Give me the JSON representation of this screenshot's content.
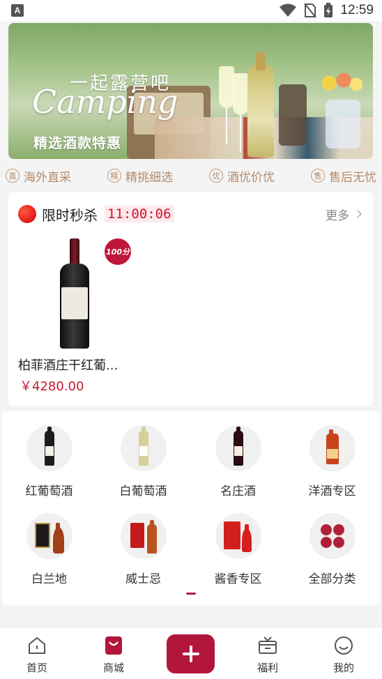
{
  "status_bar": {
    "app_badge": "A",
    "time": "12:59"
  },
  "banner": {
    "title_cn": "一起露营吧",
    "title_en": "Camping",
    "subtitle": "精选酒款特惠"
  },
  "features": [
    {
      "icon": "直",
      "label": "海外直采"
    },
    {
      "icon": "精",
      "label": "精挑细选"
    },
    {
      "icon": "优",
      "label": "酒优价优"
    },
    {
      "icon": "售",
      "label": "售后无忧"
    }
  ],
  "flash_sale": {
    "title": "限时秒杀",
    "countdown": "11:00:06",
    "more": "更多",
    "product": {
      "badge": "100分",
      "name": "柏菲酒庄干红葡...",
      "price": "￥4280.00"
    }
  },
  "categories": [
    {
      "label": "红葡萄酒",
      "icon": "red-wine-bottle-icon"
    },
    {
      "label": "白葡萄酒",
      "icon": "white-wine-bottle-icon"
    },
    {
      "label": "名庄酒",
      "icon": "fine-wine-bottle-icon"
    },
    {
      "label": "洋酒专区",
      "icon": "cognac-bottle-icon"
    },
    {
      "label": "白兰地",
      "icon": "brandy-box-icon"
    },
    {
      "label": "威士忌",
      "icon": "whisky-box-icon"
    },
    {
      "label": "酱香专区",
      "icon": "baijiu-box-icon"
    },
    {
      "label": "全部分类",
      "icon": "clover-icon"
    }
  ],
  "tabbar": {
    "tabs": [
      {
        "label": "首页"
      },
      {
        "label": "商城"
      },
      {
        "label": "福利"
      },
      {
        "label": "我的"
      }
    ]
  },
  "colors": {
    "accent": "#b3163b",
    "price": "#c41a2e",
    "feature": "#b48a6a"
  }
}
